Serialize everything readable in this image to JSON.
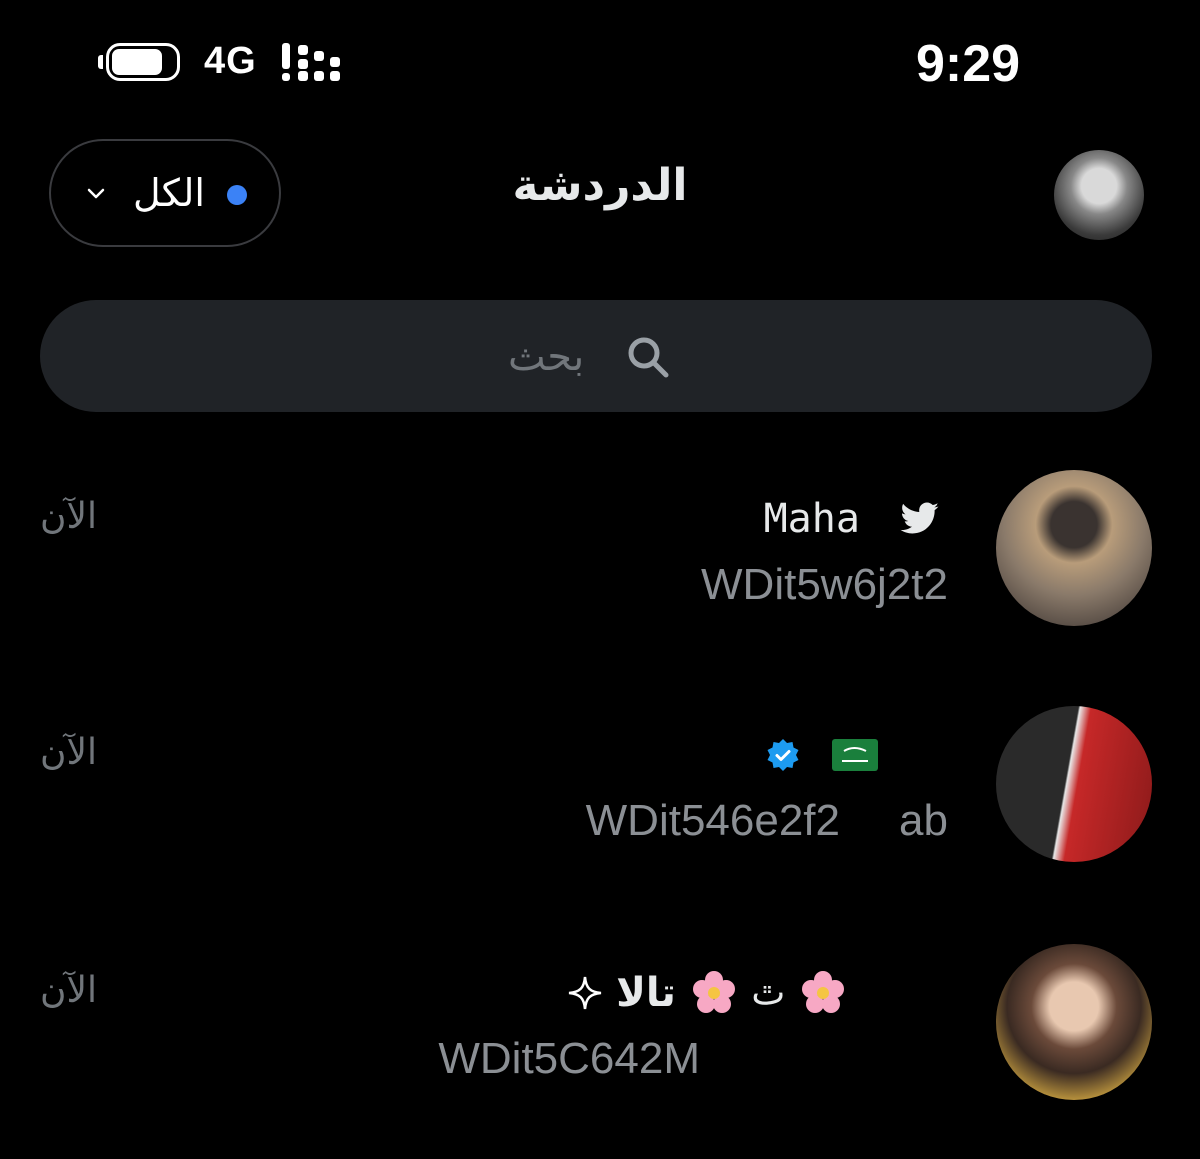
{
  "status_bar": {
    "network": "4G",
    "time": "9:29"
  },
  "header": {
    "filter_label": "الكل",
    "title": "الدردشة"
  },
  "search": {
    "placeholder": "بحث"
  },
  "chats": [
    {
      "name": "Maha",
      "handle": "WDit5w6j2t2",
      "time": "الآن",
      "icon": "bird-icon"
    },
    {
      "name": "",
      "handle": "WDit546e2f2",
      "handle_tail": "ab",
      "time": "الآن",
      "icons": [
        "verified-icon",
        "flag-icon"
      ]
    },
    {
      "name": "تالا",
      "prefix": "ﭢ",
      "handle": "WDit5C642M",
      "time": "الآن",
      "icons": [
        "sparkle-icon",
        "flower-icon"
      ]
    }
  ],
  "colors": {
    "background": "#000000",
    "accent_blue": "#3b82f6",
    "search_bg": "#202327",
    "muted_text": "#71767b"
  }
}
